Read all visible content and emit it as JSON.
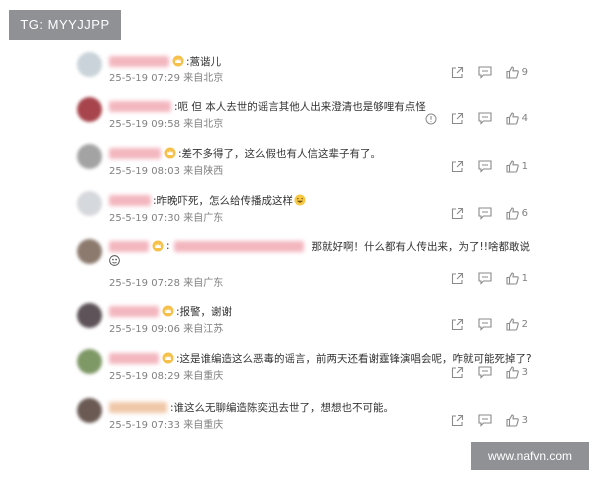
{
  "watermarks": {
    "top_left": "TG: MYYJJPP",
    "bottom_right": "www.nafvn.com"
  },
  "comments": [
    {
      "text": ":蒿谐儿",
      "date": "25-5-19 07:29",
      "location": "来自北京",
      "likes": "9",
      "avatar_color": "#c9d3d9"
    },
    {
      "text": ":呃 但 本人去世的谣言其他人出来澄清也是够哩有点怪",
      "date": "25-5-19 09:58",
      "location": "来自北京",
      "likes": "4",
      "avatar_color": "#a8454c"
    },
    {
      "text": ":差不多得了，这么假也有人信这辈子有了。",
      "date": "25-5-19 08:03",
      "location": "来自陕西",
      "likes": "1",
      "avatar_color": "#a3a3a3"
    },
    {
      "text": ":昨晚吓死，怎么给传播成这样",
      "date": "25-5-19 07:30",
      "location": "来自广东",
      "likes": "6",
      "avatar_color": "#d5d8dc"
    },
    {
      "text": ":",
      "text_after": "那就好啊！什么都有人传出来，为了!!啥都敢说",
      "date": "25-5-19 07:28",
      "location": "来自广东",
      "likes": "1",
      "avatar_color": "#8c7a6e"
    },
    {
      "text": ":报警，谢谢",
      "date": "25-5-19 09:06",
      "location": "来自江苏",
      "likes": "2",
      "avatar_color": "#5d5358"
    },
    {
      "text": ":这是谁编造这么恶毒的谣言，前两天还看谢霆锋演唱会呢，咋就可能死掉了?",
      "date": "25-5-19 08:29",
      "location": "来自重庆",
      "likes": "3",
      "avatar_color": "#7e9866"
    },
    {
      "text": ":谁这么无聊编造陈奕迅去世了，想想也不可能。",
      "date": "25-5-19 07:33",
      "location": "来自重庆",
      "likes": "3",
      "avatar_color": "#6b5a54"
    }
  ]
}
